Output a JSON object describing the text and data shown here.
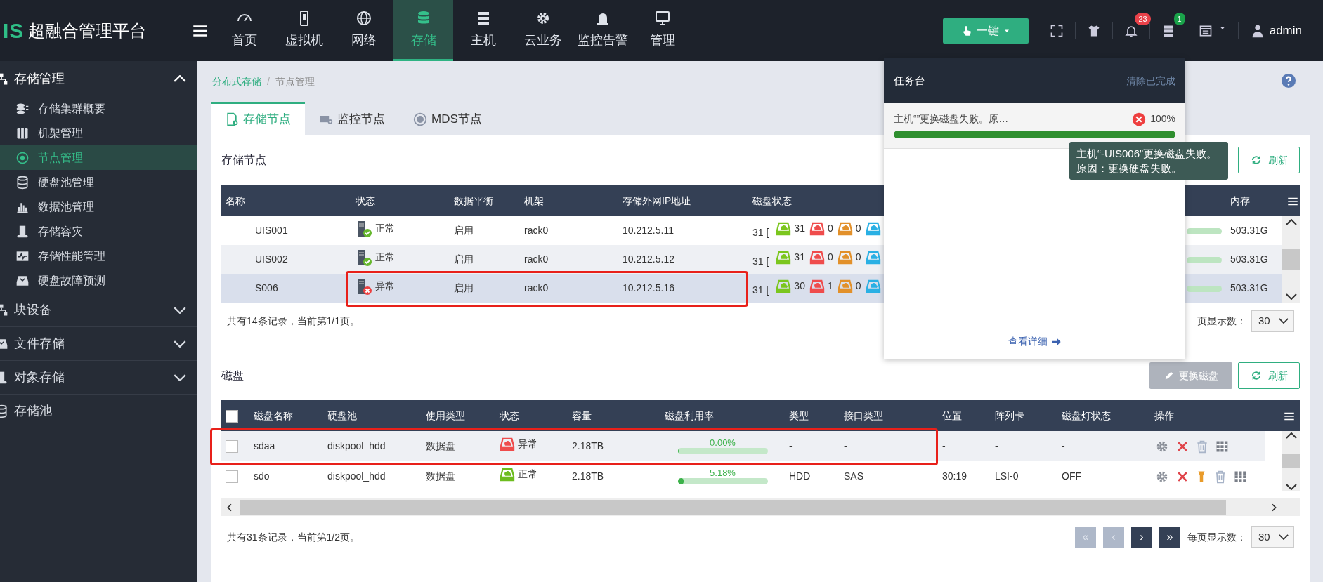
{
  "header": {
    "logo": "IS",
    "title": "超融合管理平台",
    "nav": [
      {
        "label": "首页",
        "selected": false
      },
      {
        "label": "虚拟机",
        "selected": false
      },
      {
        "label": "网络",
        "selected": false
      },
      {
        "label": "存储",
        "selected": true
      },
      {
        "label": "主机",
        "selected": false
      },
      {
        "label": "云业务",
        "selected": false
      },
      {
        "label": "监控告警",
        "selected": false
      },
      {
        "label": "管理",
        "selected": false
      }
    ],
    "quick_button": "一键",
    "alerts_badge": "23",
    "tasks_badge": "1",
    "user": "admin"
  },
  "sidebar": [
    {
      "label": "存储管理",
      "expanded": true,
      "children": [
        {
          "label": "存储集群概要",
          "selected": false
        },
        {
          "label": "机架管理",
          "selected": false
        },
        {
          "label": "节点管理",
          "selected": true
        },
        {
          "label": "硬盘池管理",
          "selected": false
        },
        {
          "label": "数据池管理",
          "selected": false
        },
        {
          "label": "存储容灾",
          "selected": false
        },
        {
          "label": "存储性能管理",
          "selected": false
        },
        {
          "label": "硬盘故障预测",
          "selected": false
        }
      ]
    },
    {
      "label": "块设备",
      "expanded": false
    },
    {
      "label": "文件存储",
      "expanded": false
    },
    {
      "label": "对象存储",
      "expanded": false
    },
    {
      "label": "存储池"
    }
  ],
  "breadcrumb": {
    "items": [
      "分布式存储",
      "节点管理"
    ],
    "separator": "/"
  },
  "tabs": [
    {
      "label": "存储节点",
      "selected": true
    },
    {
      "label": "监控节点",
      "selected": false
    },
    {
      "label": "MDS节点",
      "selected": false
    }
  ],
  "nodes": {
    "title": "存储节点",
    "refresh": "刷新",
    "columns": [
      "名称",
      "状态",
      "数据平衡",
      "机架",
      "存储外网IP地址",
      "磁盘状态",
      "内存"
    ],
    "rows": [
      {
        "name": "UIS001",
        "failed": false,
        "state_label": "正常",
        "balance": "启用",
        "rack": "rack0",
        "ip": "10.212.5.11",
        "disk_total": "31 [",
        "disk_counts": [
          "31",
          "0",
          "0"
        ],
        "memory": "503.31G",
        "highlighted": false
      },
      {
        "name": "UIS002",
        "failed": false,
        "state_label": "正常",
        "balance": "启用",
        "rack": "rack0",
        "ip": "10.212.5.12",
        "disk_total": "31 [",
        "disk_counts": [
          "31",
          "0",
          "0"
        ],
        "memory": "503.31G",
        "highlighted": false
      },
      {
        "name": "S006",
        "failed": true,
        "state_label": "异常",
        "balance": "启用",
        "rack": "rack0",
        "ip": "10.212.5.16",
        "disk_total": "31 [",
        "disk_counts": [
          "30",
          "1",
          "0"
        ],
        "memory": "503.31G",
        "highlighted": true
      }
    ],
    "footer": "共有14条记录，当前第1/1页。",
    "page_size_label": "页显示数：",
    "page_size": "30"
  },
  "disks": {
    "title": "磁盘",
    "buttons": [
      {
        "label": "更换磁盘",
        "disabled": true
      },
      {
        "label": "刷新",
        "disabled": false
      }
    ],
    "select_all": {
      "checked": false
    },
    "columns": [
      "磁盘名称",
      "硬盘池",
      "使用类型",
      "状态",
      "容量",
      "磁盘利用率",
      "类型",
      "接口类型",
      "位置",
      "阵列卡",
      "磁盘灯状态",
      "操作"
    ],
    "rows": [
      {
        "checked": false,
        "name": "sdaa",
        "pool": "diskpool_hdd",
        "usage": "数据盘",
        "failed": true,
        "state_label": "异常",
        "capacity": "2.18TB",
        "utilization": "0.00%",
        "level": 0,
        "type": "-",
        "interface": "-",
        "position": "-",
        "raid": "-",
        "light": "-",
        "locatable": false,
        "highlighted": true
      },
      {
        "checked": false,
        "name": "sdo",
        "pool": "diskpool_hdd",
        "usage": "数据盘",
        "failed": false,
        "state_label": "正常",
        "capacity": "2.18TB",
        "utilization": "5.18%",
        "level": 0.0518,
        "type": "HDD",
        "interface": "SAS",
        "position": "30:19",
        "raid": "LSI-0",
        "light": "OFF",
        "locatable": true,
        "highlighted": false
      }
    ],
    "footer": "共有31条记录，当前第1/2页。",
    "pager": [
      {
        "label": "«",
        "disabled": true
      },
      {
        "label": "‹",
        "disabled": true
      },
      {
        "label": "›",
        "disabled": false
      },
      {
        "label": "»",
        "disabled": false
      }
    ],
    "page_size_label": "每页显示数：",
    "page_size": "30"
  },
  "task_panel": {
    "title": "任务台",
    "clear": "清除已完成",
    "tasks": [
      {
        "text": "主机“”更换磁盘失败。原…",
        "failed": true,
        "percent": "100%",
        "level": 1
      }
    ],
    "details": "查看详细"
  },
  "tooltip": "主机“-UIS006”更换磁盘失败。原因：更换硬盘失败。"
}
